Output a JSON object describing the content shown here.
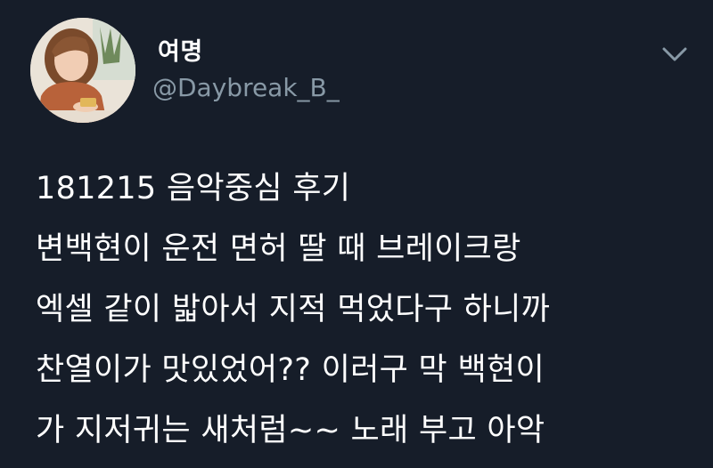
{
  "user": {
    "display_name": "여명",
    "handle": "@Daybreak_B_",
    "avatar_icon": "profile-photo"
  },
  "menu": {
    "icon": "chevron-down-icon"
  },
  "tweet": {
    "lines": [
      "181215 음악중심 후기",
      "변백현이 운전 면허 딸 때 브레이크랑",
      "엑셀 같이 밟아서 지적 먹었다구 하니까",
      "찬열이가 맛있었어?? 이러구 막 백현이",
      "가 지저귀는 새처럼~~ 노래 부고 아악"
    ]
  },
  "colors": {
    "background": "#161d29",
    "name": "#ffffff",
    "handle": "#8899a6",
    "text": "#ffffff",
    "caret": "#8899a6"
  }
}
